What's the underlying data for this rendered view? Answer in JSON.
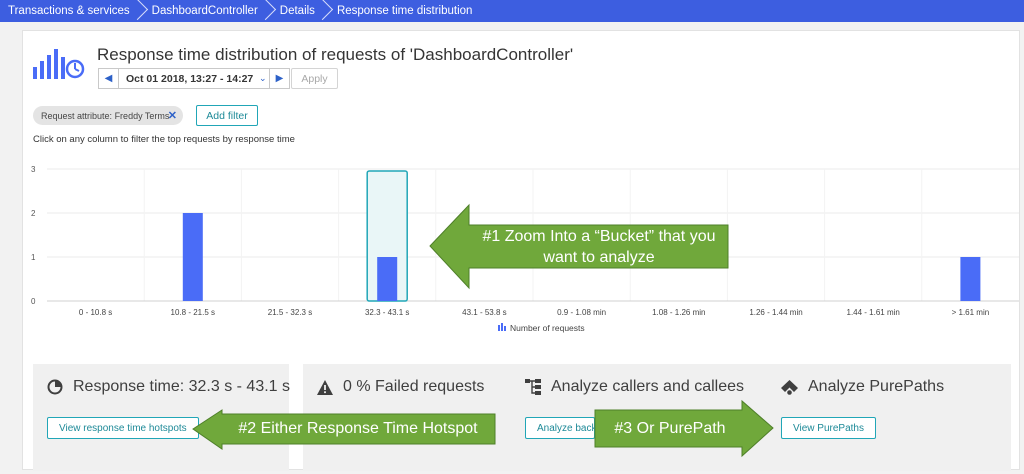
{
  "breadcrumb": [
    "Transactions & services",
    "DashboardController",
    "Details",
    "Response time distribution"
  ],
  "page_title": "Response time distribution of requests of 'DashboardController'",
  "timeframe": {
    "label": "Oct 01 2018, 13:27 - 14:27",
    "prev_icon": "triangle-left-icon",
    "next_icon": "triangle-right-icon"
  },
  "apply_label": "Apply",
  "filter_chip": {
    "key": "Request attribute:",
    "value": "Freddy Terms"
  },
  "add_filter_label": "Add filter",
  "hint": "Click on any column to filter the top requests by response time",
  "chart_data": {
    "type": "bar",
    "categories": [
      "0 - 10.8 s",
      "10.8 - 21.5 s",
      "21.5 - 32.3 s",
      "32.3 - 43.1 s",
      "43.1 - 53.8 s",
      "0.9 - 1.08 min",
      "1.08 - 1.26 min",
      "1.26 - 1.44 min",
      "1.44 - 1.61 min",
      "> 1.61 min"
    ],
    "series": [
      {
        "name": "Number of requests",
        "values": [
          0,
          2,
          0,
          1,
          0,
          0,
          0,
          0,
          0,
          1
        ]
      }
    ],
    "ylim": [
      0,
      3
    ],
    "yticks": [
      0,
      1,
      2,
      3
    ],
    "selected_category": "32.3 - 43.1 s",
    "bar_color": "#4a6cf7",
    "legend": "bottom"
  },
  "tiles": [
    {
      "title": "Response time: 32.3 s - 43.1 s",
      "icon": "response-time-icon",
      "button": "View response time hotspots"
    },
    {
      "title": "0 % Failed requests",
      "icon": "warning-icon",
      "button": ""
    },
    {
      "title": "Analyze callers and callees",
      "icon": "callers-callees-icon",
      "button": "Analyze backtrace"
    },
    {
      "title": "Analyze PurePaths",
      "icon": "purepath-icon",
      "button": "View PurePaths"
    }
  ],
  "annotations": {
    "zoom_line1": "#1 Zoom Into a “Bucket” that you",
    "zoom_line2": "want to analyze",
    "hotspot": "#2 Either Response Time Hotspot",
    "purepath": "#3 Or PurePath",
    "arrow_color": "#70a83b"
  }
}
